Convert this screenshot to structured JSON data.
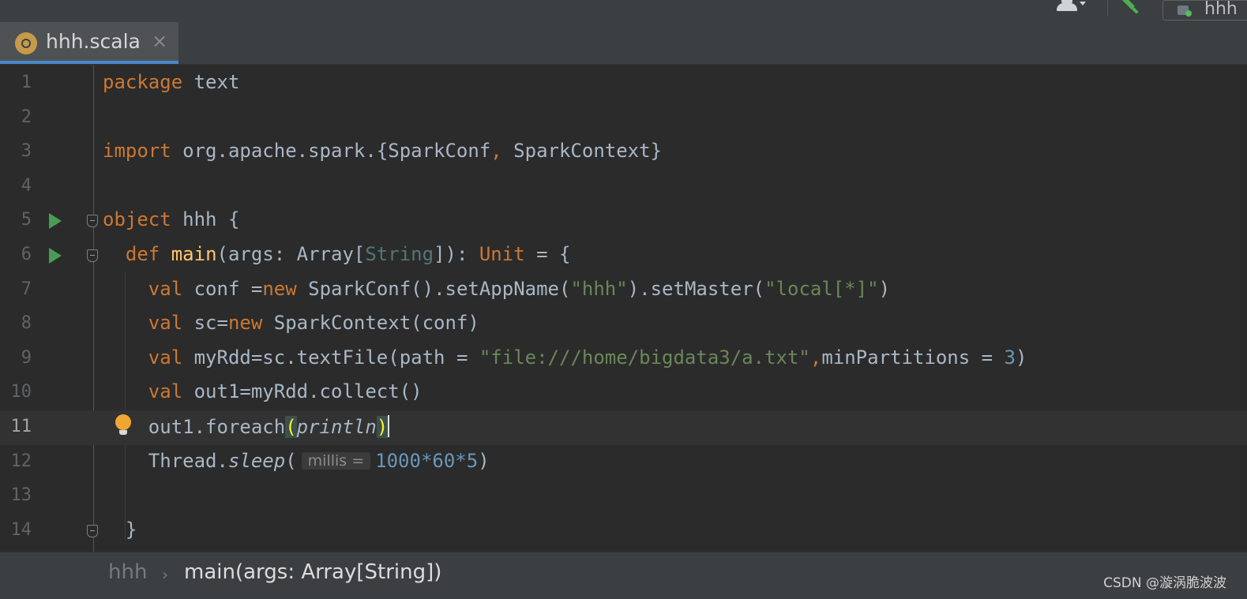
{
  "toolbar": {
    "run_config_label": "hhh"
  },
  "tab": {
    "file_name": "hhh.scala",
    "close_glyph": "×"
  },
  "editor": {
    "line_numbers": [
      "1",
      "2",
      "3",
      "4",
      "5",
      "6",
      "7",
      "8",
      "9",
      "10",
      "11",
      "12",
      "13",
      "14"
    ],
    "current_line": 11,
    "lines": {
      "l1": {
        "kw": "package",
        "rest": " text"
      },
      "l3": {
        "kw": "import",
        "pkg": " org.apache.spark.{SparkConf",
        "comma": ",",
        "rest": " SparkContext}"
      },
      "l5": {
        "kw": "object",
        "rest": " hhh {"
      },
      "l6": {
        "kw": "def",
        "fn": "main",
        "p1": "(args: Array[",
        "gen": "String",
        "p2": "]): ",
        "unit": "Unit",
        "p3": " = {"
      },
      "l7": {
        "kw": "val",
        "a": " conf =",
        "new": "new",
        "b": " SparkConf().setAppName(",
        "s1": "\"hhh\"",
        "c": ").setMaster(",
        "s2": "\"local[*]\"",
        "d": ")"
      },
      "l8": {
        "kw": "val",
        "a": " sc=",
        "new": "new",
        "b": " SparkContext(conf)"
      },
      "l9": {
        "kw": "val",
        "a": " myRdd=sc.textFile(path = ",
        "s1": "\"file:///home/bigdata3/a.txt\"",
        "comma": ",",
        "b": "minPartitions = ",
        "num": "3",
        "c": ")"
      },
      "l10": {
        "kw": "val",
        "a": " out1=myRdd.collect()"
      },
      "l11": {
        "a": "out1.foreach",
        "lp": "(",
        "it": "println",
        "rp": ")"
      },
      "l12": {
        "a": "Thread.",
        "it": "sleep",
        "lp": "(",
        "hint": "millis =",
        "num": "1000*60*5",
        "rp": ")"
      },
      "l14": {
        "a": "}"
      }
    }
  },
  "breadcrumb": {
    "item1": "hhh",
    "separator": "›",
    "item2": "main(args: Array[String])"
  },
  "watermark": "CSDN @漩涡脆波波"
}
